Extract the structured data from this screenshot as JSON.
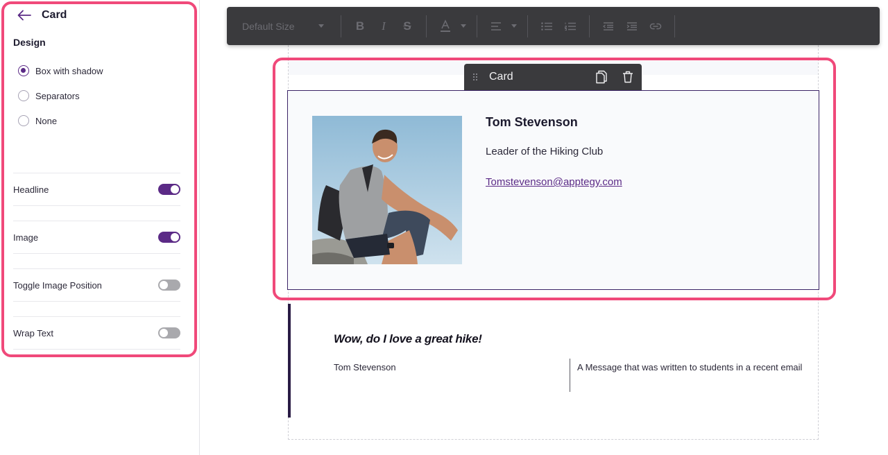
{
  "panel": {
    "title": "Card",
    "design_label": "Design",
    "design_options": [
      {
        "label": "Box with shadow",
        "selected": true
      },
      {
        "label": "Separators",
        "selected": false
      },
      {
        "label": "None",
        "selected": false
      }
    ],
    "toggles": [
      {
        "label": "Headline",
        "on": true
      },
      {
        "label": "Image",
        "on": true
      },
      {
        "label": "Toggle Image Position",
        "on": false
      },
      {
        "label": "Wrap Text",
        "on": false
      }
    ],
    "accent_color": "#5b2a86",
    "highlight_color": "#f0497a"
  },
  "toolbar": {
    "font_size_label": "Default Size",
    "icons": [
      "bold-icon",
      "italic-icon",
      "strikethrough-icon",
      "text-color-icon",
      "align-icon",
      "bullet-list-icon",
      "numbered-list-icon",
      "outdent-icon",
      "indent-icon",
      "link-icon"
    ]
  },
  "card_chip": {
    "label": "Card",
    "icons": [
      "drag-handle-icon",
      "duplicate-icon",
      "trash-icon"
    ]
  },
  "card": {
    "name": "Tom Stevenson",
    "role": "Leader of the Hiking Club",
    "email": "Tomstevenson@apptegy.com"
  },
  "quote": {
    "title": "Wow, do I love a great hike!",
    "author": "Tom Stevenson",
    "description": "A Message that was written to students in a recent email"
  }
}
